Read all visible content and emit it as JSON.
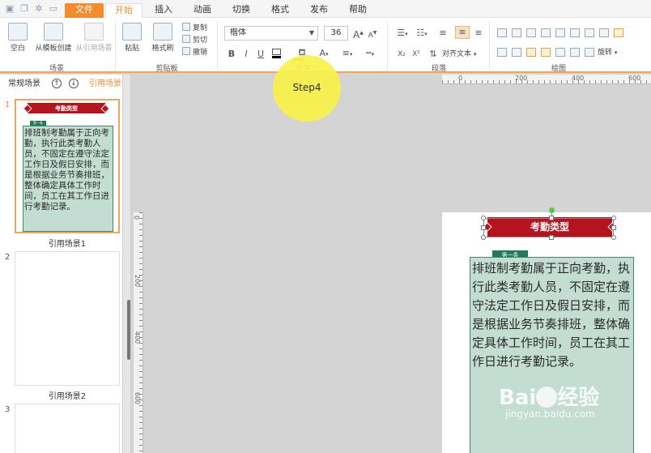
{
  "menu": {
    "tabs": [
      "文件",
      "开始",
      "插入",
      "动画",
      "切换",
      "格式",
      "发布",
      "帮助"
    ]
  },
  "ribbon": {
    "scene": {
      "blank": "空白",
      "from_template": "从模板创建",
      "from_ref_scene": "从引用场景",
      "group_label": "场景"
    },
    "clipboard": {
      "paste": "粘贴",
      "format_painter": "格式刷",
      "copy": "复制",
      "cut": "剪切",
      "undo": "撤销",
      "group_label": "剪贴板"
    },
    "text": {
      "font_name": "楷体",
      "font_size": "36",
      "bold": "B",
      "italic": "I",
      "underline": "U",
      "grow": "A",
      "shrink": "A",
      "group_label": "文字"
    },
    "paragraph": {
      "align_text": "对齐文本",
      "group_label": "段落"
    },
    "drawing": {
      "rotate": "旋转",
      "group_label": "绘图"
    }
  },
  "left_panel": {
    "tab_normal": "常规场景",
    "tab_reference": "引用场景",
    "slides": [
      {
        "number": "1",
        "caption": "引用场景1"
      },
      {
        "number": "2",
        "caption": "引用场景2"
      },
      {
        "number": "3",
        "caption": ""
      }
    ]
  },
  "slide": {
    "title": "考勤类型",
    "tag": "第一条",
    "body": "排班制考勤属于正向考勤，执行此类考勤人员，不固定在遵守法定工作日及假日安排，而是根据业务节奏排班，整体确定具体工作时间，员工在其工作日进行考勤记录。"
  },
  "rulers": {
    "h_marks": [
      "0",
      "200",
      "400",
      "600"
    ],
    "v_marks": [
      "0",
      "200",
      "400",
      "600"
    ]
  },
  "annotation": {
    "step_label": "Step4"
  },
  "watermark": {
    "brand": "Bai",
    "brand2": "经验",
    "url": "jingyan.baidu.com"
  },
  "colors": {
    "accent": "#f38c2e",
    "banner_red": "#b5141f",
    "tag_green": "#1f7a57",
    "body_bg": "#c3ddd3",
    "bubble_yellow": "#f8f24a"
  }
}
